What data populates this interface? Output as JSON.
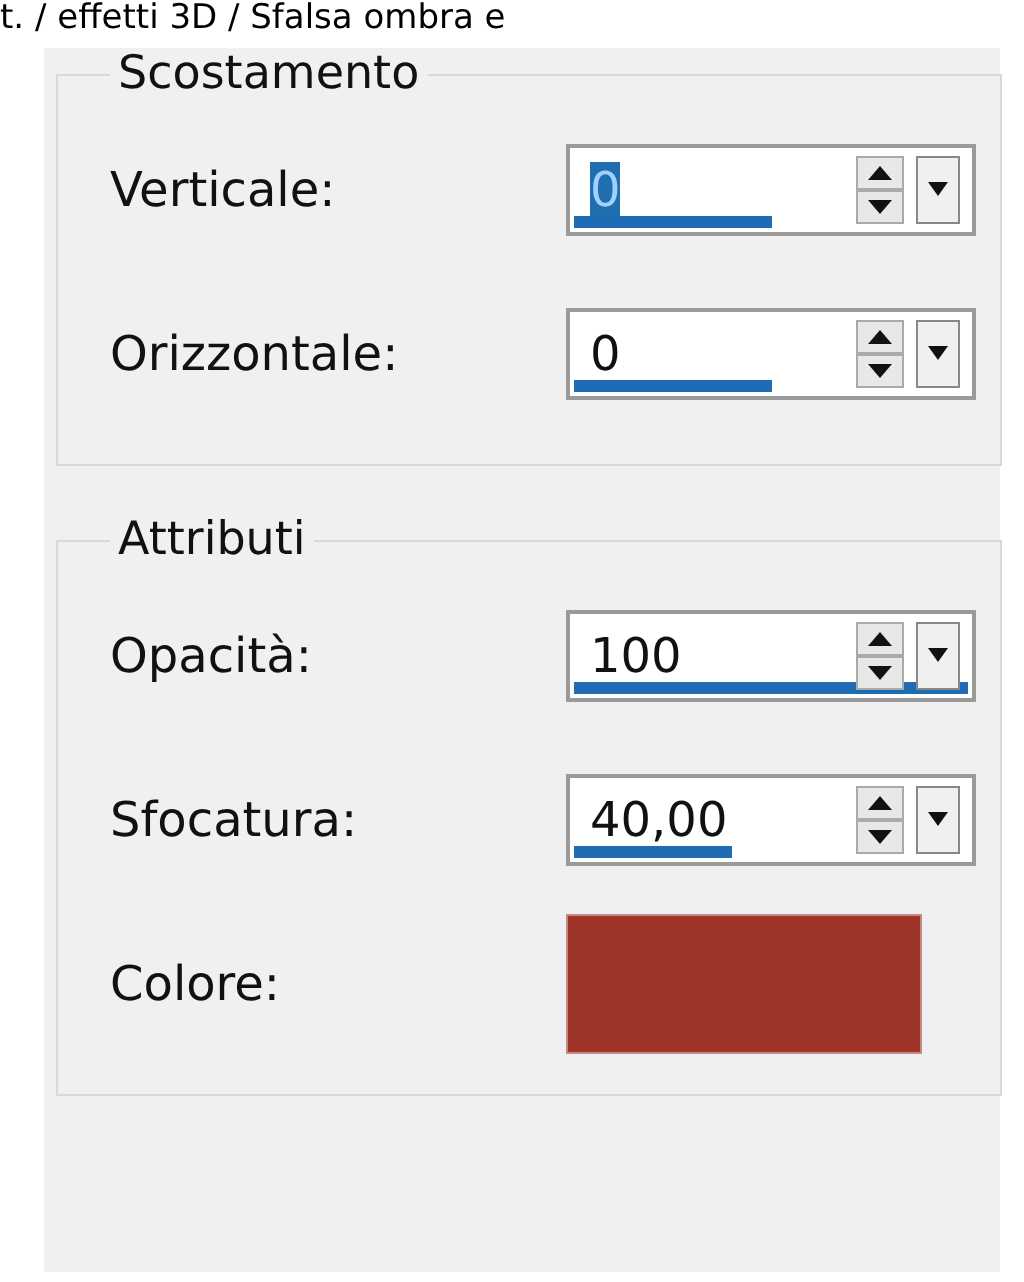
{
  "caption": "t. / effetti 3D / Sfalsa ombra e",
  "groups": [
    {
      "title": "Scostamento",
      "rows": [
        {
          "kind": "spin",
          "label": "Verticale:",
          "value": "0",
          "highlighted": true,
          "level": 0.5
        },
        {
          "kind": "spin",
          "label": "Orizzontale:",
          "value": "0",
          "highlighted": false,
          "level": 0.5
        }
      ]
    },
    {
      "title": "Attributi",
      "rows": [
        {
          "kind": "spin",
          "label": "Opacità:",
          "value": "100",
          "highlighted": false,
          "level": 1
        },
        {
          "kind": "spin",
          "label": "Sfocatura:",
          "value": "40,00",
          "highlighted": false,
          "level": 0.4
        },
        {
          "kind": "swatch",
          "label": "Colore:",
          "color": "#9e3328"
        }
      ]
    }
  ]
}
